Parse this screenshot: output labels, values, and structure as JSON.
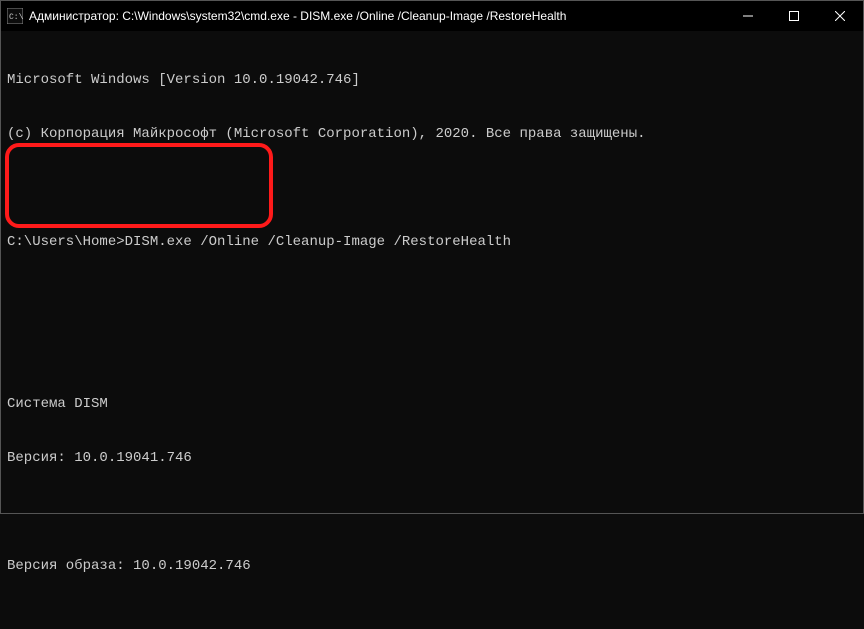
{
  "window": {
    "title": "Администратор: C:\\Windows\\system32\\cmd.exe - DISM.exe  /Online  /Cleanup-Image  /RestoreHealth"
  },
  "terminal": {
    "line1": "Microsoft Windows [Version 10.0.19042.746]",
    "line2": "(c) Корпорация Майкрософт (Microsoft Corporation), 2020. Все права защищены.",
    "prompt": "C:\\Users\\Home>",
    "command": "DISM.exe /Online /Cleanup-Image /RestoreHealth",
    "dism_header": "Cистема DISM",
    "dism_version": "Версия: 10.0.19041.746",
    "image_version": "Версия образа: 10.0.19042.746"
  },
  "colors": {
    "highlight": "#ff1a1a",
    "bg": "#0c0c0c",
    "text": "#cccccc"
  }
}
